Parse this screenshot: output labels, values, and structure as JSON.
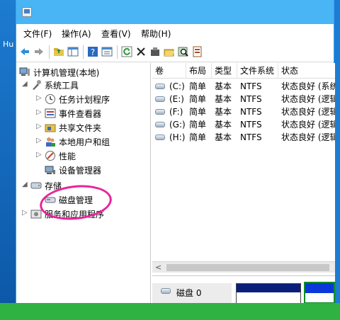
{
  "desktop": {
    "partial_text": "Hu"
  },
  "window": {
    "title": ""
  },
  "menu": [
    "文件(F)",
    "操作(A)",
    "查看(V)",
    "帮助(H)"
  ],
  "toolbar": {
    "icons": [
      "back-icon",
      "forward-icon",
      "up-folder-icon",
      "show-tree-icon",
      "help-icon",
      "properties-icon",
      "refresh-icon",
      "delete-icon",
      "settings-icon",
      "open-icon",
      "search-icon",
      "export-icon"
    ]
  },
  "tree": {
    "root": "计算机管理(本地)",
    "system_tools": "系统工具",
    "task_scheduler": "任务计划程序",
    "event_viewer": "事件查看器",
    "shared_folders": "共享文件夹",
    "local_users": "本地用户和组",
    "performance": "性能",
    "device_manager": "设备管理器",
    "storage": "存储",
    "disk_management": "磁盘管理",
    "services_apps": "服务和应用程序"
  },
  "volumes": {
    "columns": [
      "卷",
      "布局",
      "类型",
      "文件系统",
      "状态"
    ],
    "rows": [
      {
        "volume": "(C:)",
        "layout": "简单",
        "type": "基本",
        "fs": "NTFS",
        "status": "状态良好 (系统"
      },
      {
        "volume": "(E:)",
        "layout": "简单",
        "type": "基本",
        "fs": "NTFS",
        "status": "状态良好 (逻辑"
      },
      {
        "volume": "(F:)",
        "layout": "简单",
        "type": "基本",
        "fs": "NTFS",
        "status": "状态良好 (逻辑"
      },
      {
        "volume": "(G:)",
        "layout": "简单",
        "type": "基本",
        "fs": "NTFS",
        "status": "状态良好 (逻辑"
      },
      {
        "volume": "(H:)",
        "layout": "简单",
        "type": "基本",
        "fs": "NTFS",
        "status": "状态良好 (逻辑"
      }
    ]
  },
  "diskpane": {
    "disk_label": "磁盘 0"
  },
  "colors": {
    "titlebar": "#4ab5f5",
    "annotation": "#e8239a",
    "partition_primary": "#0a1f7a",
    "partition_selected": "#0c38d8"
  }
}
